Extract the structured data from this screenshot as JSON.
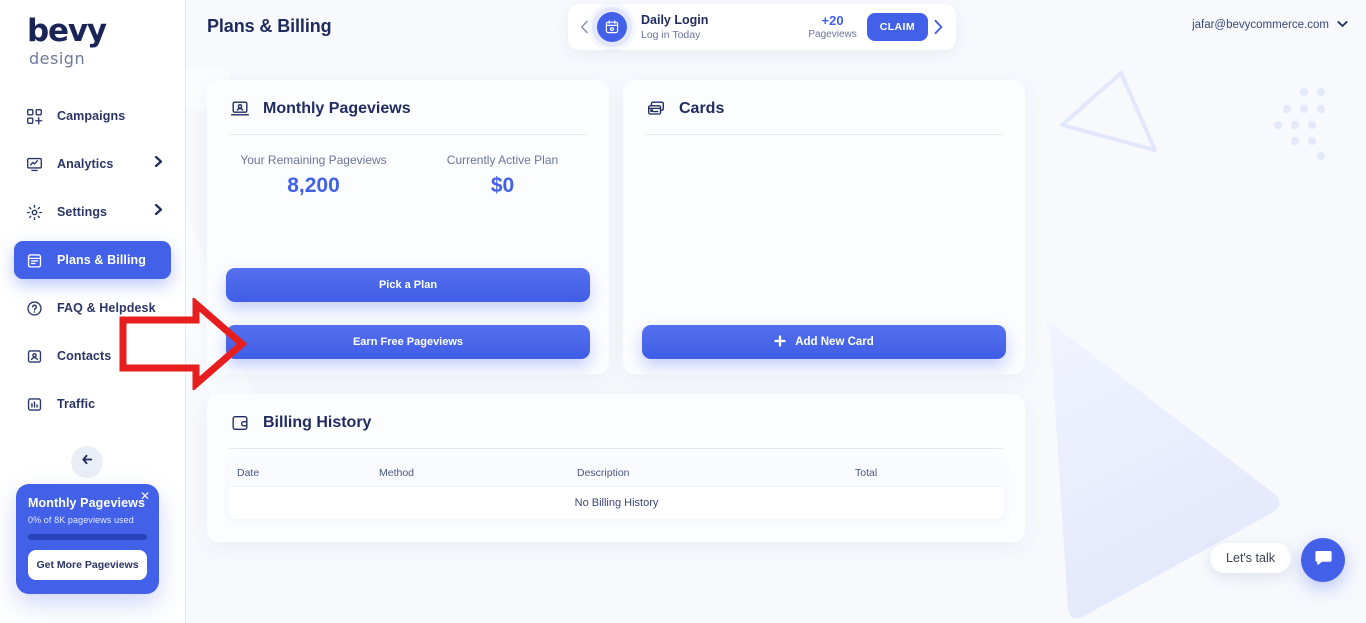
{
  "brand": {
    "name": "bevy",
    "tagline": "design",
    "accent": "#4360e8",
    "ink": "#1f2a5e"
  },
  "header": {
    "title": "Plans & Billing",
    "user_email": "jafar@bevycommerce.com",
    "user_chevron_icon": "chevron-down-icon"
  },
  "daily_login": {
    "prev_icon": "chevron-left-icon",
    "next_icon": "chevron-right-icon",
    "badge_icon": "calendar-clock-icon",
    "title": "Daily Login",
    "subtitle": "Log in Today",
    "reward_amount": "+20",
    "reward_unit": "Pageviews",
    "claim_label": "CLAIM"
  },
  "sidebar": {
    "items": [
      {
        "label": "Campaigns",
        "icon": "grid-plus-icon",
        "has_chevron": false,
        "active": false
      },
      {
        "label": "Analytics",
        "icon": "monitor-chart-icon",
        "has_chevron": true,
        "active": false
      },
      {
        "label": "Settings",
        "icon": "gear-icon",
        "has_chevron": true,
        "active": false
      },
      {
        "label": "Plans & Billing",
        "icon": "calendar-list-icon",
        "has_chevron": false,
        "active": true
      },
      {
        "label": "FAQ & Helpdesk",
        "icon": "question-circle-icon",
        "has_chevron": false,
        "active": false
      },
      {
        "label": "Contacts",
        "icon": "contact-card-icon",
        "has_chevron": false,
        "active": false
      },
      {
        "label": "Traffic",
        "icon": "bar-chart-icon",
        "has_chevron": false,
        "active": false
      }
    ],
    "collapse_icon": "arrow-left-icon",
    "promo": {
      "title": "Monthly Pageviews",
      "subtitle": "0% of 8K pageviews used",
      "progress_percent": 0,
      "cta_label": "Get More Pageviews",
      "close_icon": "close-icon"
    }
  },
  "panels": {
    "pageviews": {
      "icon": "laptop-user-icon",
      "title": "Monthly Pageviews",
      "stats": [
        {
          "label": "Your Remaining Pageviews",
          "value": "8,200"
        },
        {
          "label": "Currently Active Plan",
          "value": "$0"
        }
      ],
      "pick_plan_label": "Pick a Plan",
      "earn_free_label": "Earn Free Pageviews"
    },
    "cards": {
      "icon": "credit-cards-icon",
      "title": "Cards",
      "add_card_label": "Add New Card",
      "add_card_icon": "plus-icon",
      "empty": ""
    },
    "billing": {
      "icon": "wallet-icon",
      "title": "Billing History",
      "columns": [
        "Date",
        "Method",
        "Description",
        "Total"
      ],
      "empty_message": "No Billing History"
    }
  },
  "chat": {
    "label": "Let's talk",
    "icon": "chat-bubble-icon"
  },
  "annotation": {
    "arrow_color": "#e81d1d",
    "arrow_target": "earn-free-pageviews-button"
  }
}
